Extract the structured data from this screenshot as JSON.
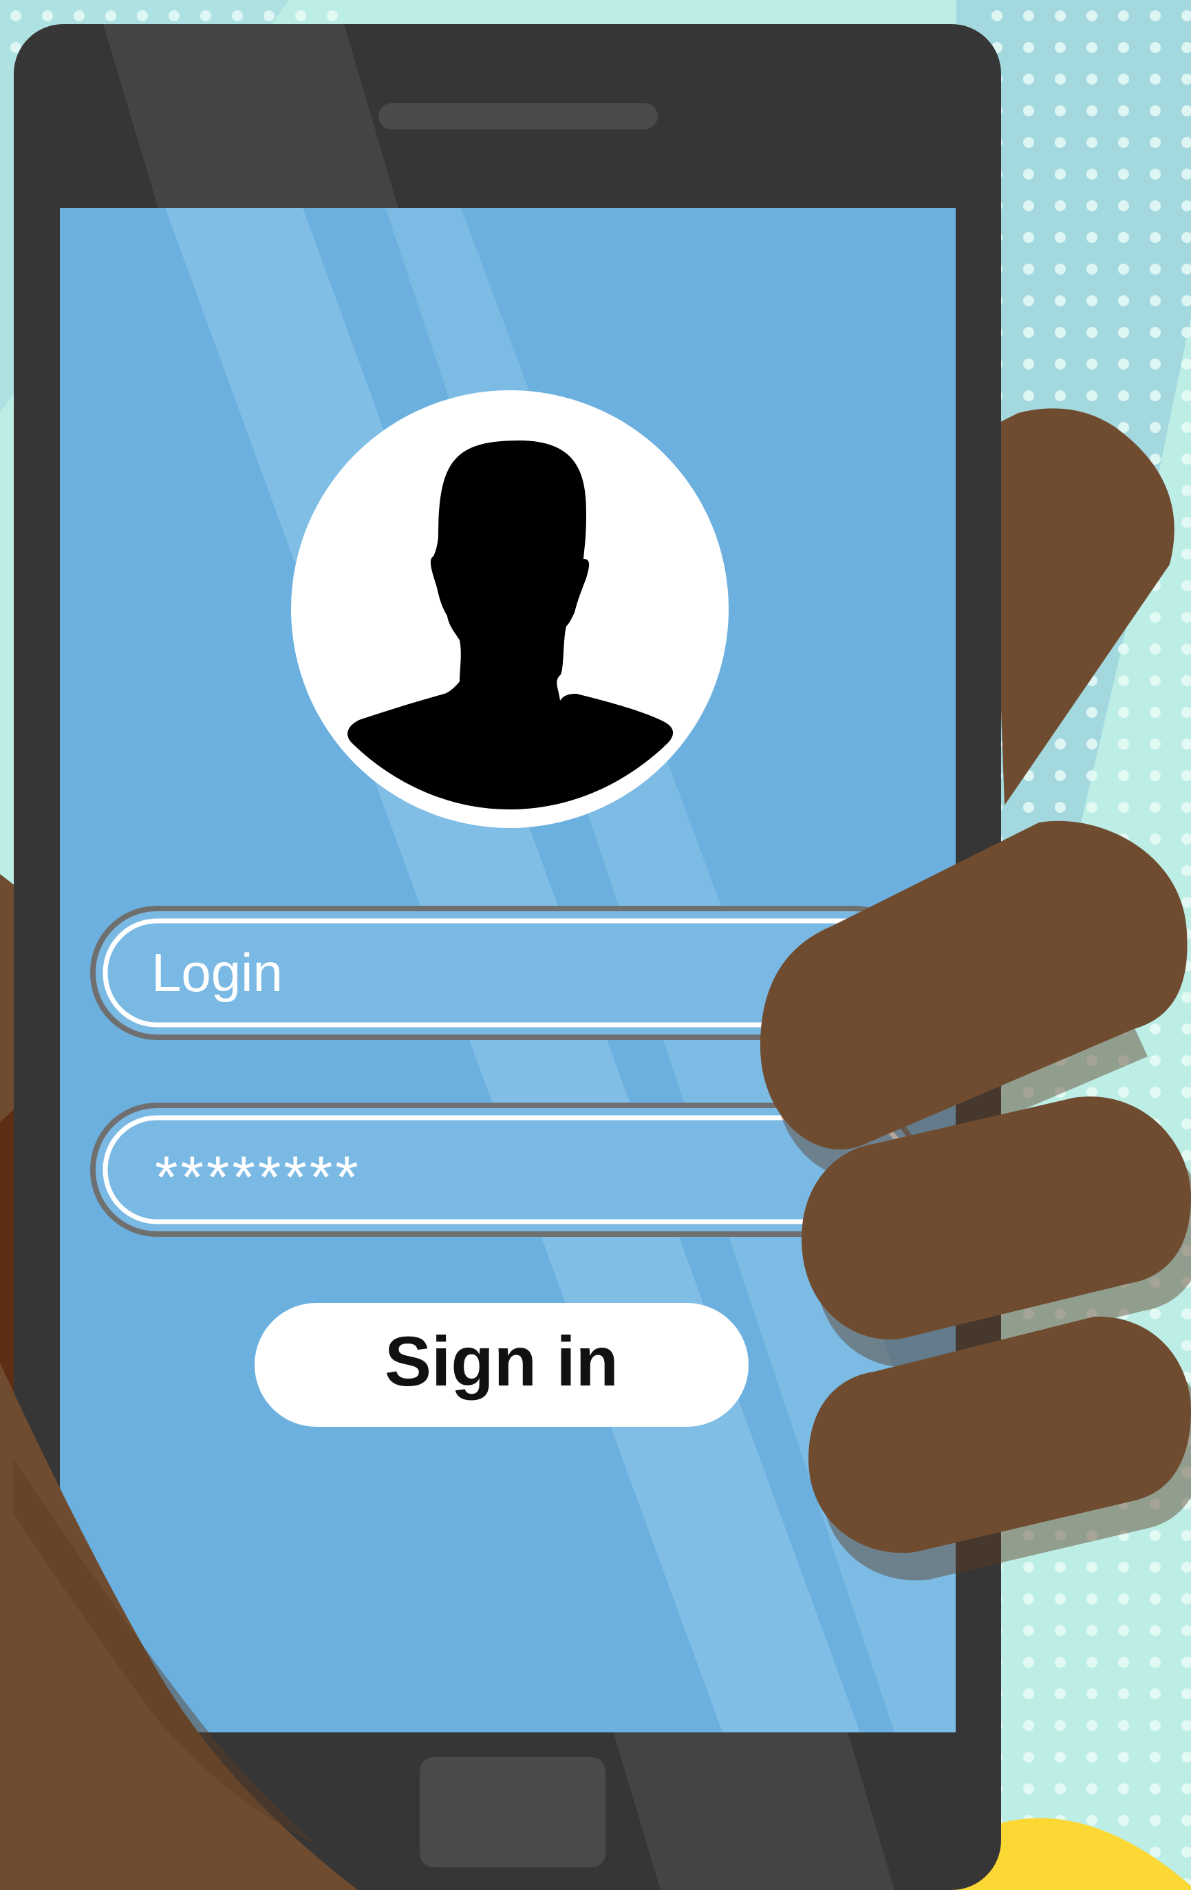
{
  "login_screen": {
    "username_value": "Login",
    "password_value": "********",
    "sign_in_label": "Sign in"
  },
  "icons": {
    "avatar": "user-silhouette-icon"
  },
  "colors": {
    "background": "#bdeee6",
    "background_stripe": "#a3d8df",
    "dots": "#e8fbf7",
    "phone_body": "#363636",
    "phone_highlight": "#4a4a4a",
    "screen": "#6bb0df",
    "screen_glare": "#8ec6ea",
    "field_border": "#6f6f6f",
    "field_inner": "#ffffff",
    "text_light": "#ffffff",
    "button_bg": "#ffffff",
    "button_text": "#111111",
    "silhouette": "#000000",
    "skin": "#6f4c30",
    "skin_shadow": "#5a3b24",
    "yellow_accent": "#fcd835"
  }
}
